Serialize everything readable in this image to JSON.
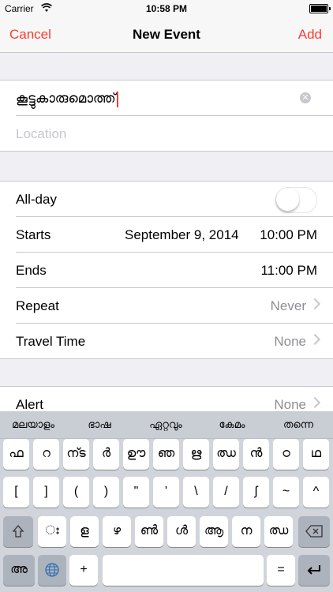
{
  "status_bar": {
    "carrier": "Carrier",
    "time": "10:58 PM"
  },
  "nav": {
    "cancel": "Cancel",
    "title": "New Event",
    "add": "Add"
  },
  "event": {
    "title_value": "കൂട്ടുകാരുമൊത്ത്",
    "location_placeholder": "Location"
  },
  "details": {
    "allday_label": "All-day",
    "starts_label": "Starts",
    "starts_date": "September 9, 2014",
    "starts_time": "10:00 PM",
    "ends_label": "Ends",
    "ends_time": "11:00 PM",
    "repeat_label": "Repeat",
    "repeat_value": "Never",
    "travel_label": "Travel Time",
    "travel_value": "None"
  },
  "alert": {
    "label": "Alert",
    "value": "None"
  },
  "keyboard": {
    "suggestions": [
      "മലയാളം",
      "ഭാഷ",
      "ഏറ്റവും",
      "കേമം",
      "തന്നെ"
    ],
    "row1": [
      "ഫ",
      "റ",
      "ന്ട",
      "ർ",
      "ഊ",
      "ഞ",
      "ഋ",
      "ഝ",
      "ൻ",
      "ഠ",
      "ഥ"
    ],
    "row2": [
      "[",
      "]",
      "(",
      ")",
      "\"",
      "'",
      "\\",
      "/",
      "ʃ",
      "~",
      "^"
    ],
    "row3": [
      "ഃ",
      "ള",
      "ഴ",
      "ൺ",
      "ൾ",
      "ആ",
      "ന",
      "ഝ"
    ],
    "bottom": {
      "lang_key": "അ",
      "plus_key": "+",
      "equals_key": "="
    }
  }
}
